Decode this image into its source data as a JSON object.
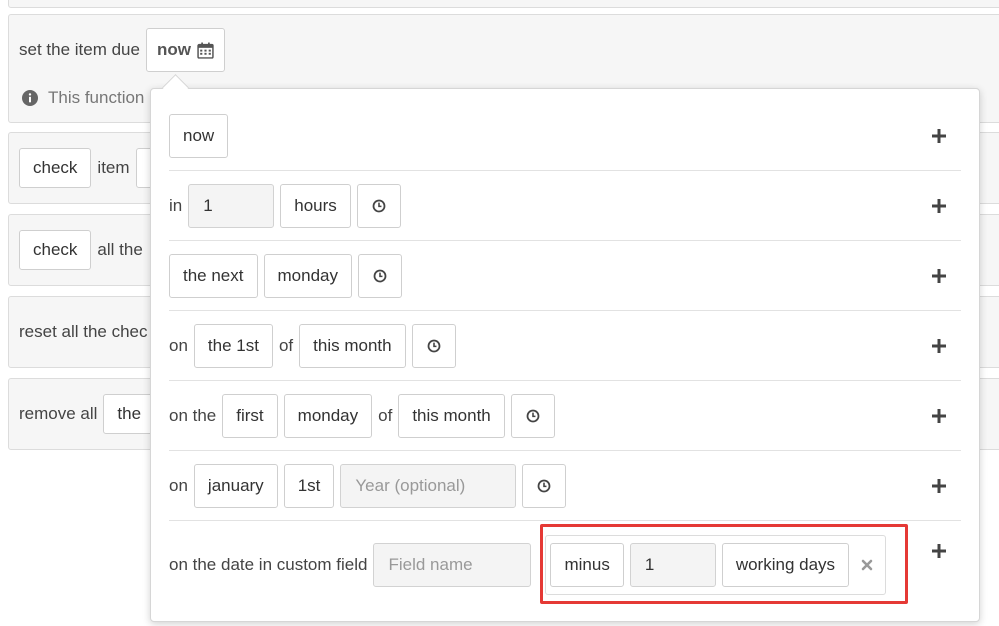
{
  "background": {
    "due_label": "set the item due",
    "due_value": "now",
    "info_text": "This function",
    "check_item": {
      "btn": "check",
      "word": "item"
    },
    "check_all": {
      "btn": "check",
      "word": "all the"
    },
    "reset_text": "reset all the chec",
    "remove": {
      "word": "remove all",
      "btn": "the"
    }
  },
  "options": {
    "now": {
      "label": "now"
    },
    "in_hours": {
      "prefix": "in",
      "value": "1",
      "unit": "hours"
    },
    "next_day": {
      "which": "the next",
      "day": "monday"
    },
    "day_of_month": {
      "prefix": "on",
      "day": "the 1st",
      "of": "of",
      "month": "this month"
    },
    "weekday_of_month": {
      "prefix": "on the",
      "ordinal": "first",
      "day": "monday",
      "of": "of",
      "month": "this month"
    },
    "date": {
      "prefix": "on",
      "month": "january",
      "day": "1st",
      "year_placeholder": "Year (optional)"
    },
    "custom_field": {
      "prefix": "on the date in custom field",
      "field_placeholder": "Field name",
      "op": "minus",
      "amount": "1",
      "unit": "working days"
    }
  },
  "colors": {
    "icon": "#444444",
    "highlight": "#e53935",
    "remove": "#999999"
  }
}
